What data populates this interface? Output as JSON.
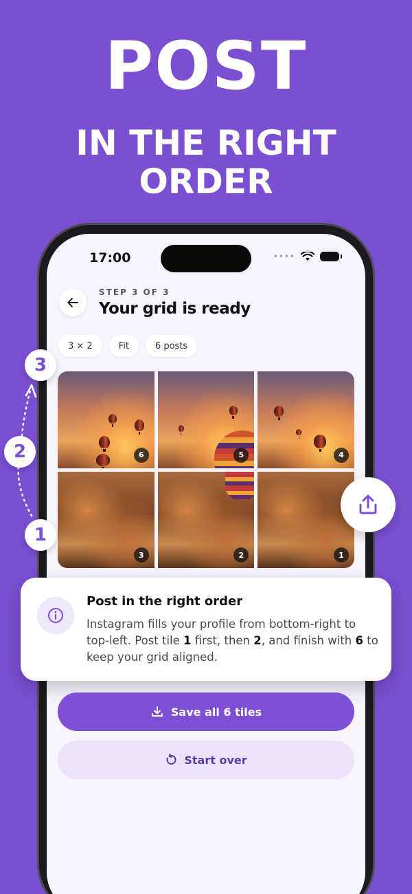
{
  "hero": {
    "title": "POST",
    "subtitle_line1": "IN THE RIGHT",
    "subtitle_line2": "ORDER"
  },
  "status_bar": {
    "time": "17:00"
  },
  "header": {
    "step": "STEP 3 OF 3",
    "title": "Your grid is ready"
  },
  "chips": [
    "3 × 2",
    "Fit",
    "6 posts"
  ],
  "grid": {
    "tiles": [
      {
        "badge": "6"
      },
      {
        "badge": "5"
      },
      {
        "badge": "4"
      },
      {
        "badge": "3"
      },
      {
        "badge": "2"
      },
      {
        "badge": "1"
      }
    ]
  },
  "order_markers": [
    "1",
    "2",
    "3"
  ],
  "info_card": {
    "title": "Post in the right order",
    "body_part1": "Instagram fills your profile from bottom-right to top-left. Post tile ",
    "tile_first": "1",
    "body_part2": " first, then ",
    "tile_second": "2",
    "body_part3": ", and finish with ",
    "tile_last": "6",
    "body_part4": " to keep your grid aligned."
  },
  "buttons": {
    "save_all": "Save all 6 tiles",
    "start_over": "Start over"
  },
  "colors": {
    "background": "#7b4fd2",
    "accent": "#7c4fd5",
    "secondary_button": "#ece3fa"
  }
}
